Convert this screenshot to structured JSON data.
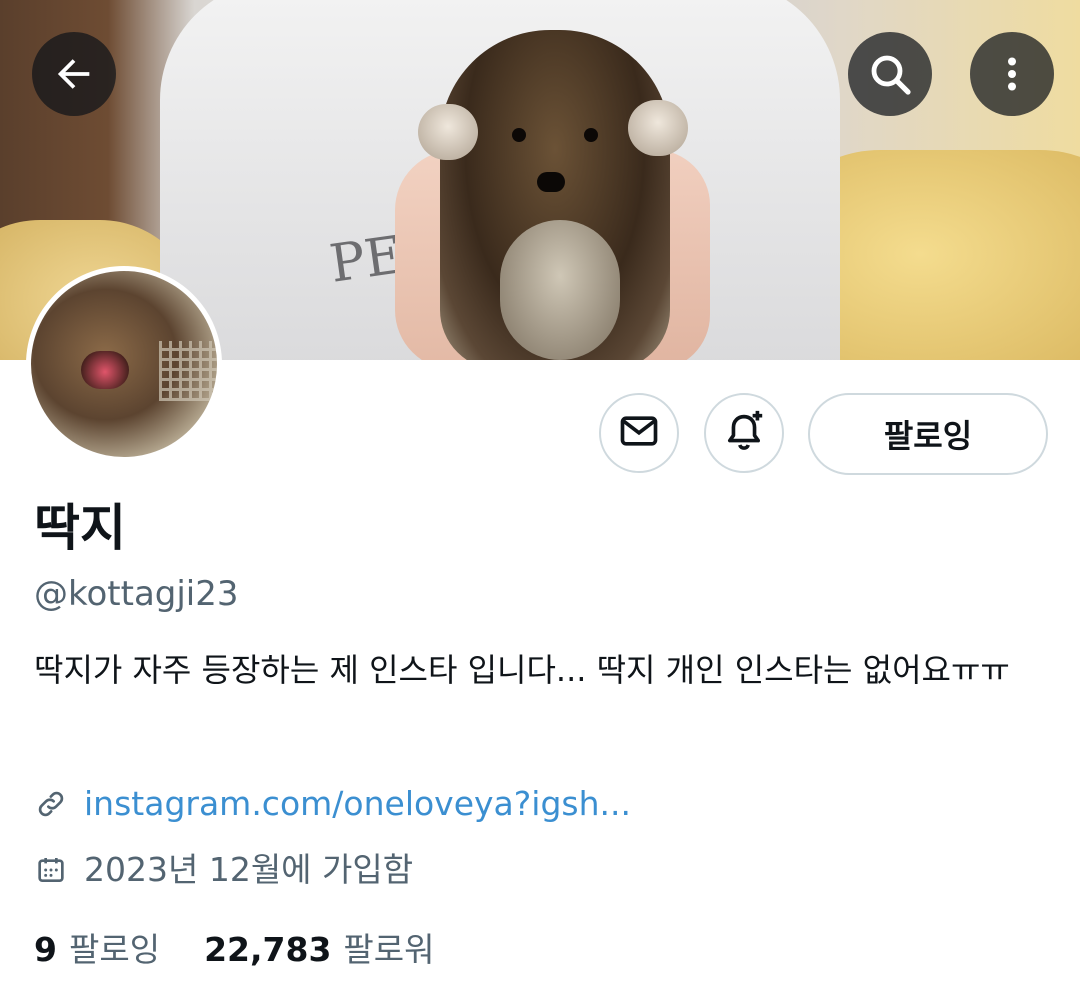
{
  "header": {
    "back_icon": "arrow-left-icon",
    "search_icon": "search-icon",
    "more_icon": "more-vertical-icon"
  },
  "banner": {
    "shirt_text": "PE"
  },
  "actions": {
    "message_icon": "envelope-icon",
    "notify_icon": "bell-plus-icon",
    "follow_label": "팔로잉"
  },
  "profile": {
    "name": "딱지",
    "handle": "@kottagji23",
    "bio": "딱지가 자주 등장하는 제 인스타 입니다... 딱지 개인 인스타는 없어요ㅠㅠ",
    "link": "instagram.com/oneloveya?igsh...",
    "joined": "2023년 12월에 가입함"
  },
  "stats": {
    "following_count": "9",
    "following_label": "팔로잉",
    "followers_count": "22,783",
    "followers_label": "팔로워"
  },
  "colors": {
    "link": "#3b8fd1",
    "secondary_text": "#536471",
    "border": "#cfd9de"
  }
}
